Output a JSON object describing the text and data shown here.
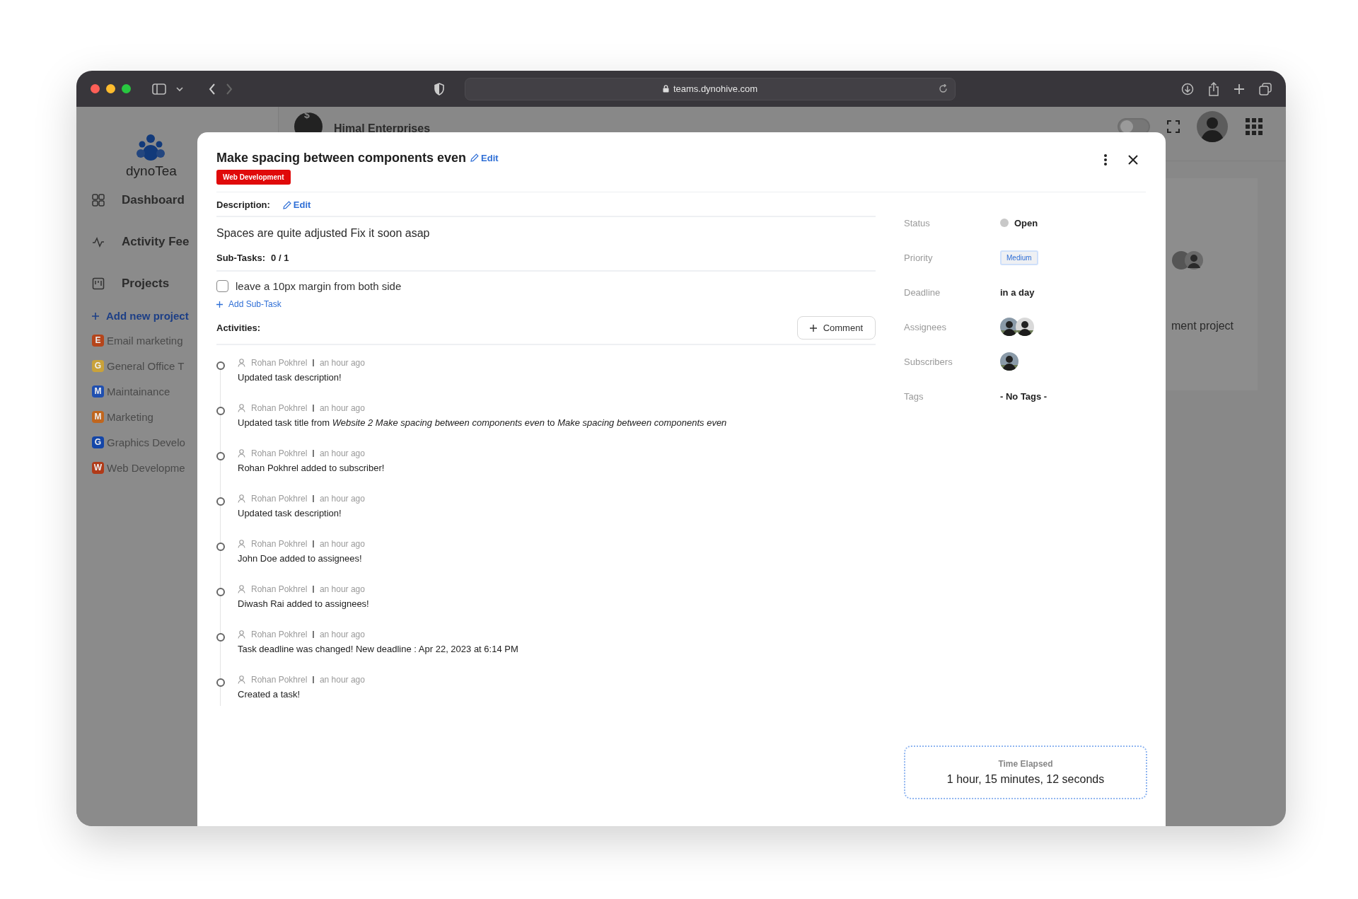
{
  "browser": {
    "url": "teams.dynohive.com"
  },
  "sidebar": {
    "logo": "dynoTea",
    "items": [
      {
        "label": "Dashboard",
        "kind": "grid"
      },
      {
        "label": "Activity Fee",
        "kind": "pulse"
      },
      {
        "label": "Projects",
        "kind": "board"
      }
    ],
    "add_project": "Add new project",
    "projects": [
      {
        "letter": "E",
        "name": "Email marketing",
        "color": "#b5451b"
      },
      {
        "letter": "G",
        "name": "General Office T",
        "color": "#c9a23a"
      },
      {
        "letter": "M",
        "name": "Maintainance",
        "color": "#1f4fb0"
      },
      {
        "letter": "M",
        "name": "Marketing",
        "color": "#c0661e"
      },
      {
        "letter": "G",
        "name": "Graphics Develo",
        "color": "#1446a8"
      },
      {
        "letter": "W",
        "name": "Web Developme",
        "color": "#b03a18"
      }
    ]
  },
  "header": {
    "company": "Himal Enterprises",
    "company_glyph": "$",
    "toggle": {
      "on": false
    }
  },
  "background": {
    "snippet": "ment project"
  },
  "task": {
    "title": "Make spacing between components even",
    "edit": "Edit",
    "tag": "Web Development",
    "description_label": "Description:",
    "description_edit": "Edit",
    "description": "Spaces are quite adjusted Fix it soon asap",
    "subtasks_label": "Sub-Tasks:",
    "subtasks_count": "0 / 1",
    "subtasks": [
      {
        "label": "leave a 10px margin from both side",
        "checked": false
      }
    ],
    "add_subtask": "Add Sub-Task",
    "activities_label": "Activities:",
    "comment_button": "Comment",
    "activities": [
      {
        "user": "Rohan Pokhrel",
        "time": "an hour ago",
        "text": "Updated task description!"
      },
      {
        "user": "Rohan Pokhrel",
        "time": "an hour ago",
        "text": "Updated task title from *Website 2 Make spacing between components even* to *Make spacing between components even*"
      },
      {
        "user": "Rohan Pokhrel",
        "time": "an hour ago",
        "text": "Rohan Pokhrel added to subscriber!"
      },
      {
        "user": "Rohan Pokhrel",
        "time": "an hour ago",
        "text": "Updated task description!"
      },
      {
        "user": "Rohan Pokhrel",
        "time": "an hour ago",
        "text": "John Doe added to assignees!"
      },
      {
        "user": "Rohan Pokhrel",
        "time": "an hour ago",
        "text": "Diwash Rai added to assignees!"
      },
      {
        "user": "Rohan Pokhrel",
        "time": "an hour ago",
        "text": "Task deadline was changed! New deadline : Apr 22, 2023 at 6:14 PM"
      },
      {
        "user": "Rohan Pokhrel",
        "time": "an hour ago",
        "text": "Created a task!"
      }
    ],
    "details": [
      {
        "label": "Status",
        "kind": "status",
        "value": "Open",
        "color": "#c8c8c8"
      },
      {
        "label": "Priority",
        "kind": "priority",
        "value": "Medium"
      },
      {
        "label": "Deadline",
        "kind": "text",
        "value": "in a day"
      },
      {
        "label": "Assignees",
        "kind": "avatars"
      },
      {
        "label": "Subscribers",
        "kind": "avatars"
      },
      {
        "label": "Tags",
        "kind": "text",
        "value": "- No Tags -"
      }
    ],
    "time_elapsed": {
      "label": "Time Elapsed",
      "value": "1 hour, 15 minutes, 12 seconds"
    }
  }
}
